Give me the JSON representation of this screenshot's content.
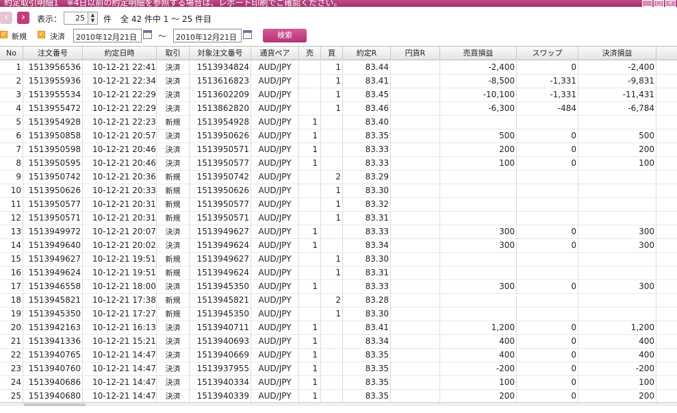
{
  "window": {
    "title": "約定取引明細1　※4日以前の約定明細を参照する場合は、レポート印刷でご確認ください。",
    "btn_min": "_",
    "btn_max": "□",
    "btn_close": "×"
  },
  "toolbar": {
    "prev_icon": "‹",
    "next_icon": "›",
    "display_label": "表示：",
    "page_size": "25",
    "unit": "件",
    "summary": "全 42 件中 1 ～ 25 件目"
  },
  "filter": {
    "new_label": "新規",
    "settle_label": "決済",
    "date_from": "2010年12月21日",
    "tilde": "～",
    "date_to": "2010年12月21日",
    "search_label": "検索"
  },
  "table": {
    "headers": [
      "No",
      "注文番号",
      "約定日時",
      "取引",
      "対象注文番号",
      "通貨ペア",
      "売",
      "買",
      "約定R",
      "円貨R",
      "売買損益",
      "スワップ",
      "決済損益"
    ],
    "rows": [
      [
        "1",
        "1513956536",
        "10-12-21 22:41",
        "決済",
        "1513934824",
        "AUD/JPY",
        "",
        "1",
        "83.44",
        "",
        "-2,400",
        "0",
        "-2,400"
      ],
      [
        "2",
        "1513955936",
        "10-12-21 22:34",
        "決済",
        "1513616823",
        "AUD/JPY",
        "",
        "1",
        "83.41",
        "",
        "-8,500",
        "-1,331",
        "-9,831"
      ],
      [
        "3",
        "1513955534",
        "10-12-21 22:29",
        "決済",
        "1513602209",
        "AUD/JPY",
        "",
        "1",
        "83.45",
        "",
        "-10,100",
        "-1,331",
        "-11,431"
      ],
      [
        "4",
        "1513955472",
        "10-12-21 22:29",
        "決済",
        "1513862820",
        "AUD/JPY",
        "",
        "1",
        "83.46",
        "",
        "-6,300",
        "-484",
        "-6,784"
      ],
      [
        "5",
        "1513954928",
        "10-12-21 22:23",
        "新規",
        "1513954928",
        "AUD/JPY",
        "1",
        "",
        "83.40",
        "",
        "",
        "",
        ""
      ],
      [
        "6",
        "1513950858",
        "10-12-21 20:57",
        "決済",
        "1513950626",
        "AUD/JPY",
        "1",
        "",
        "83.35",
        "",
        "500",
        "0",
        "500"
      ],
      [
        "7",
        "1513950598",
        "10-12-21 20:46",
        "決済",
        "1513950571",
        "AUD/JPY",
        "1",
        "",
        "83.33",
        "",
        "200",
        "0",
        "200"
      ],
      [
        "8",
        "1513950595",
        "10-12-21 20:46",
        "決済",
        "1513950577",
        "AUD/JPY",
        "1",
        "",
        "83.33",
        "",
        "100",
        "0",
        "100"
      ],
      [
        "9",
        "1513950742",
        "10-12-21 20:36",
        "新規",
        "1513950742",
        "AUD/JPY",
        "",
        "2",
        "83.29",
        "",
        "",
        "",
        ""
      ],
      [
        "10",
        "1513950626",
        "10-12-21 20:33",
        "新規",
        "1513950626",
        "AUD/JPY",
        "",
        "1",
        "83.30",
        "",
        "",
        "",
        ""
      ],
      [
        "11",
        "1513950577",
        "10-12-21 20:31",
        "新規",
        "1513950577",
        "AUD/JPY",
        "",
        "1",
        "83.32",
        "",
        "",
        "",
        ""
      ],
      [
        "12",
        "1513950571",
        "10-12-21 20:31",
        "新規",
        "1513950571",
        "AUD/JPY",
        "",
        "1",
        "83.31",
        "",
        "",
        "",
        ""
      ],
      [
        "13",
        "1513949972",
        "10-12-21 20:07",
        "決済",
        "1513949627",
        "AUD/JPY",
        "1",
        "",
        "83.33",
        "",
        "300",
        "0",
        "300"
      ],
      [
        "14",
        "1513949640",
        "10-12-21 20:02",
        "決済",
        "1513949624",
        "AUD/JPY",
        "1",
        "",
        "83.34",
        "",
        "300",
        "0",
        "300"
      ],
      [
        "15",
        "1513949627",
        "10-12-21 19:51",
        "新規",
        "1513949627",
        "AUD/JPY",
        "",
        "1",
        "83.30",
        "",
        "",
        "",
        ""
      ],
      [
        "16",
        "1513949624",
        "10-12-21 19:51",
        "新規",
        "1513949624",
        "AUD/JPY",
        "",
        "1",
        "83.31",
        "",
        "",
        "",
        ""
      ],
      [
        "17",
        "1513946558",
        "10-12-21 18:00",
        "決済",
        "1513945350",
        "AUD/JPY",
        "1",
        "",
        "83.33",
        "",
        "300",
        "0",
        "300"
      ],
      [
        "18",
        "1513945821",
        "10-12-21 17:38",
        "新規",
        "1513945821",
        "AUD/JPY",
        "",
        "2",
        "83.28",
        "",
        "",
        "",
        ""
      ],
      [
        "19",
        "1513945350",
        "10-12-21 17:27",
        "新規",
        "1513945350",
        "AUD/JPY",
        "",
        "1",
        "83.30",
        "",
        "",
        "",
        ""
      ],
      [
        "20",
        "1513942163",
        "10-12-21 16:13",
        "決済",
        "1513940711",
        "AUD/JPY",
        "1",
        "",
        "83.41",
        "",
        "1,200",
        "0",
        "1,200"
      ],
      [
        "21",
        "1513941336",
        "10-12-21 15:21",
        "決済",
        "1513940693",
        "AUD/JPY",
        "1",
        "",
        "83.34",
        "",
        "400",
        "0",
        "400"
      ],
      [
        "22",
        "1513940765",
        "10-12-21 14:47",
        "決済",
        "1513940669",
        "AUD/JPY",
        "1",
        "",
        "83.35",
        "",
        "400",
        "0",
        "400"
      ],
      [
        "23",
        "1513940760",
        "10-12-21 14:47",
        "決済",
        "1513937955",
        "AUD/JPY",
        "1",
        "",
        "83.35",
        "",
        "-200",
        "0",
        "-200"
      ],
      [
        "24",
        "1513940686",
        "10-12-21 14:47",
        "決済",
        "1513940334",
        "AUD/JPY",
        "1",
        "",
        "83.35",
        "",
        "100",
        "0",
        "100"
      ],
      [
        "25",
        "1513940680",
        "10-12-21 14:47",
        "決済",
        "1513940339",
        "AUD/JPY",
        "1",
        "",
        "83.35",
        "",
        "200",
        "0",
        "200"
      ]
    ]
  },
  "colors": {
    "accent": "#b33276",
    "checkbox": "#f5b13d"
  },
  "icons": {
    "prev": "chevron-left-icon",
    "next": "chevron-right-icon",
    "calendar": "calendar-icon"
  }
}
